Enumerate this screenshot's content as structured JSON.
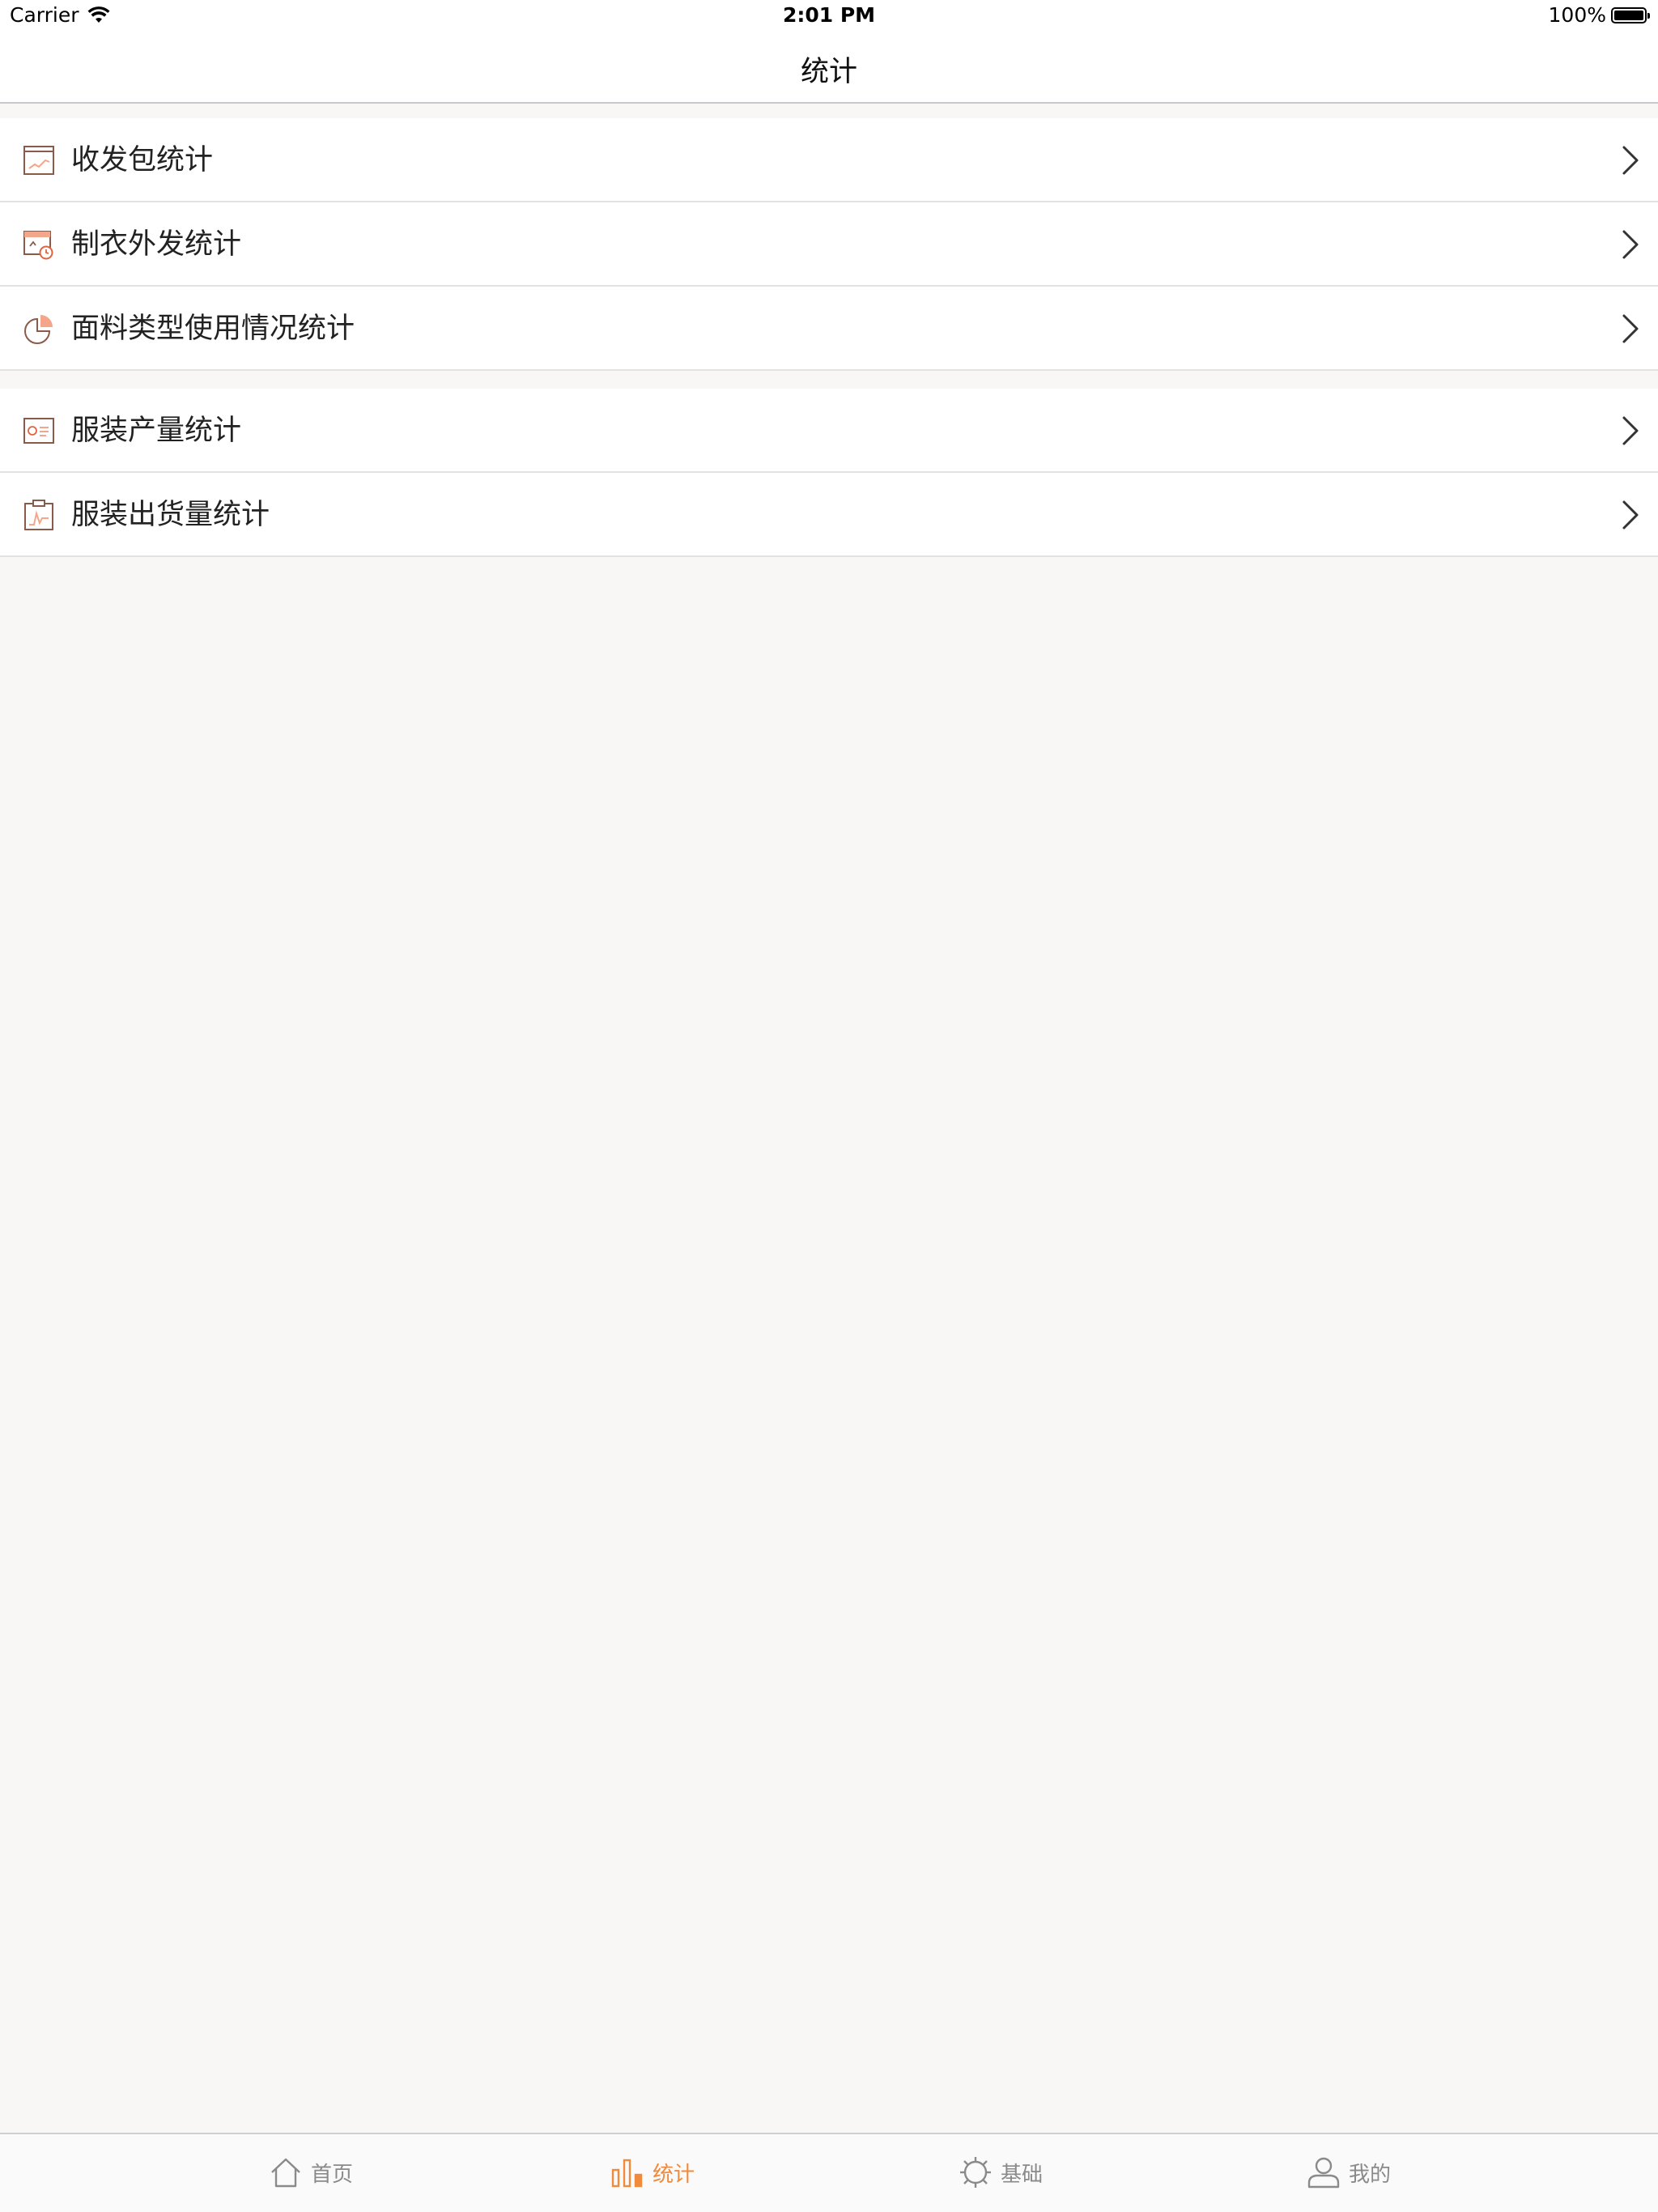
{
  "status_bar": {
    "carrier": "Carrier",
    "time": "2:01 PM",
    "battery": "100%"
  },
  "nav": {
    "title": "统计"
  },
  "groups": [
    {
      "items": [
        {
          "label": "收发包统计",
          "icon": "line-chart-window-icon"
        },
        {
          "label": "制衣外发统计",
          "icon": "calendar-clock-icon"
        },
        {
          "label": "面料类型使用情况统计",
          "icon": "pie-chart-icon"
        }
      ]
    },
    {
      "items": [
        {
          "label": "服装产量统计",
          "icon": "report-card-icon"
        },
        {
          "label": "服装出货量统计",
          "icon": "clipboard-chart-icon"
        }
      ]
    }
  ],
  "tab_bar": {
    "tabs": [
      {
        "label": "首页",
        "icon": "home-icon",
        "active": false
      },
      {
        "label": "统计",
        "icon": "bar-chart-icon",
        "active": true
      },
      {
        "label": "基础",
        "icon": "gear-icon",
        "active": false
      },
      {
        "label": "我的",
        "icon": "person-icon",
        "active": false
      }
    ]
  },
  "colors": {
    "accent": "#f08a3c",
    "icon_brown": "#8a5a4a",
    "icon_salmon": "#f4a68b",
    "background": "#f8f7f6"
  }
}
